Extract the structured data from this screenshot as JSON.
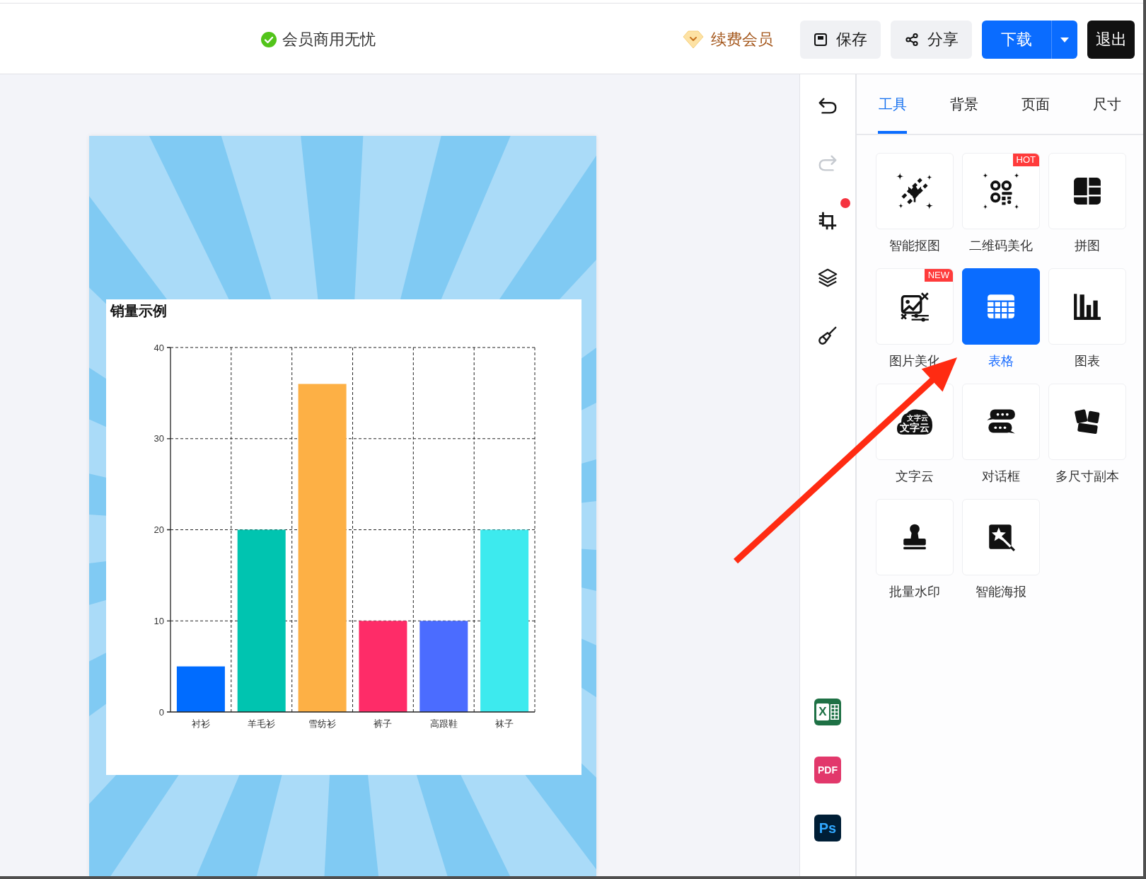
{
  "header": {
    "notice": "会员商用无忧",
    "renew_link": "续费会员",
    "buttons": [
      {
        "kind": "save",
        "label": "保存",
        "dropdown": false
      },
      {
        "kind": "share",
        "label": "分享",
        "dropdown": false
      },
      {
        "kind": "download",
        "label": "下载",
        "dropdown": true
      },
      {
        "kind": "exit",
        "label": "退出",
        "dropdown": false
      }
    ]
  },
  "canvas": {
    "chart": {
      "chart_data": {
        "type": "bar",
        "title": "销量示例",
        "categories": [
          "衬衫",
          "羊毛衫",
          "雪纺衫",
          "裤子",
          "高跟鞋",
          "袜子"
        ],
        "values": [
          5,
          20,
          36,
          10,
          10,
          20
        ],
        "ylim": [
          0,
          40
        ],
        "yticks": [
          0,
          10,
          20,
          30,
          40
        ],
        "grid": true
      }
    }
  },
  "toolbar": [
    {
      "kind": "undo",
      "disabled": false,
      "notification": false
    },
    {
      "kind": "redo",
      "disabled": true,
      "notification": false
    },
    {
      "kind": "crop",
      "disabled": false,
      "notification": true
    },
    {
      "kind": "layers",
      "disabled": false,
      "notification": false
    },
    {
      "kind": "clean",
      "disabled": false,
      "notification": false
    }
  ],
  "export_buttons": [
    {
      "kind": "excel",
      "label": "X"
    },
    {
      "kind": "pdf",
      "label": "PDF"
    },
    {
      "kind": "photoshop",
      "label": "Ps"
    }
  ],
  "panel": {
    "tabs": [
      {
        "label": "工具",
        "selected": true
      },
      {
        "label": "背景",
        "selected": false
      },
      {
        "label": "页面",
        "selected": false
      },
      {
        "label": "尺寸",
        "selected": false
      }
    ],
    "tools": [
      {
        "kind": "cutout",
        "label": "智能抠图",
        "selected": false
      },
      {
        "kind": "qrcode",
        "label": "二维码美化",
        "selected": false,
        "tag": "HOT"
      },
      {
        "kind": "collage",
        "label": "拼图",
        "selected": false
      },
      {
        "kind": "photo",
        "label": "图片美化",
        "selected": false,
        "tag": "NEW"
      },
      {
        "kind": "table",
        "label": "表格",
        "selected": true
      },
      {
        "kind": "chart",
        "label": "图表",
        "selected": false
      },
      {
        "kind": "wordcloud",
        "label": "文字云",
        "selected": false,
        "icon_text": [
          "文字云",
          "文字云"
        ]
      },
      {
        "kind": "dialog",
        "label": "对话框",
        "selected": false
      },
      {
        "kind": "multisize",
        "label": "多尺寸副本",
        "selected": false
      },
      {
        "kind": "watermark",
        "label": "批量水印",
        "selected": false
      },
      {
        "kind": "poster",
        "label": "智能海报",
        "selected": false
      }
    ]
  }
}
